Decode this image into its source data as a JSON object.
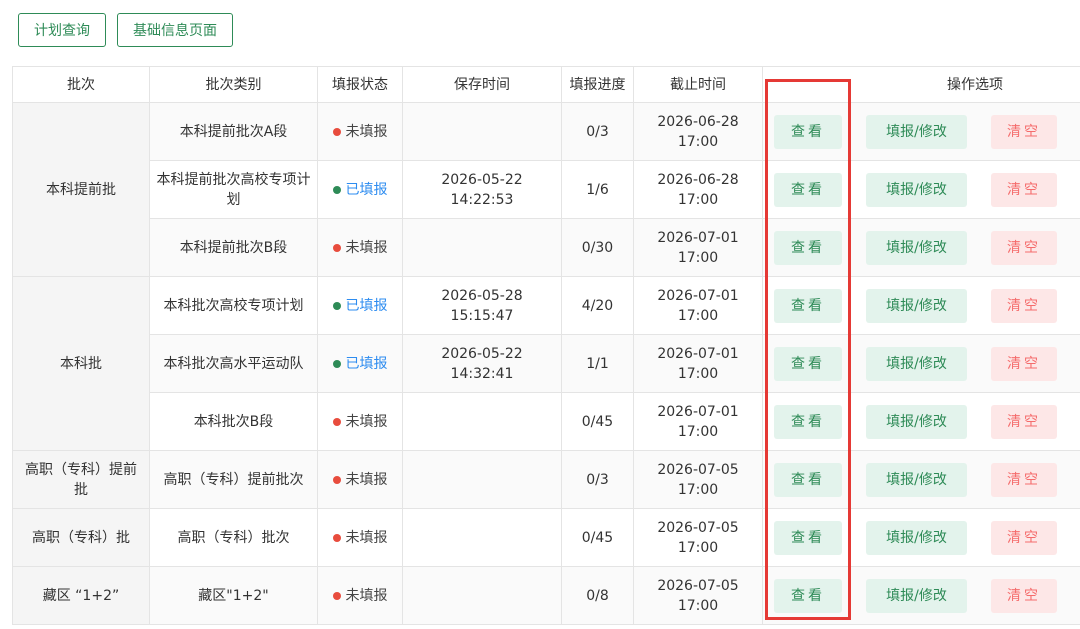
{
  "toolbar": {
    "query_label": "计划查询",
    "basic_info_label": "基础信息页面"
  },
  "table": {
    "headers": {
      "batch": "批次",
      "category": "批次类别",
      "status": "填报状态",
      "save_time": "保存时间",
      "progress": "填报进度",
      "deadline": "截止时间",
      "operations": "操作选项"
    },
    "groups": [
      {
        "name": "本科提前批",
        "rows": 3
      },
      {
        "name": "本科批",
        "rows": 3
      },
      {
        "name": "高职（专科）提前批",
        "rows": 1
      },
      {
        "name": "高职（专科）批",
        "rows": 1
      },
      {
        "name": "藏区 “1+2”",
        "rows": 1
      }
    ],
    "rows": [
      {
        "category": "本科提前批次A段",
        "status": "未填报",
        "status_type": "unfilled",
        "save_date": "",
        "save_time": "",
        "progress": "0/3",
        "deadline_date": "2026-06-28",
        "deadline_time": "17:00"
      },
      {
        "category": "本科提前批次高校专项计划",
        "status": "已填报",
        "status_type": "filled",
        "save_date": "2026-05-22",
        "save_time": "14:22:53",
        "progress": "1/6",
        "deadline_date": "2026-06-28",
        "deadline_time": "17:00"
      },
      {
        "category": "本科提前批次B段",
        "status": "未填报",
        "status_type": "unfilled",
        "save_date": "",
        "save_time": "",
        "progress": "0/30",
        "deadline_date": "2026-07-01",
        "deadline_time": "17:00"
      },
      {
        "category": "本科批次高校专项计划",
        "status": "已填报",
        "status_type": "filled",
        "save_date": "2026-05-28",
        "save_time": "15:15:47",
        "progress": "4/20",
        "deadline_date": "2026-07-01",
        "deadline_time": "17:00"
      },
      {
        "category": "本科批次高水平运动队",
        "status": "已填报",
        "status_type": "filled",
        "save_date": "2026-05-22",
        "save_time": "14:32:41",
        "progress": "1/1",
        "deadline_date": "2026-07-01",
        "deadline_time": "17:00"
      },
      {
        "category": "本科批次B段",
        "status": "未填报",
        "status_type": "unfilled",
        "save_date": "",
        "save_time": "",
        "progress": "0/45",
        "deadline_date": "2026-07-01",
        "deadline_time": "17:00"
      },
      {
        "category": "高职（专科）提前批次",
        "status": "未填报",
        "status_type": "unfilled",
        "save_date": "",
        "save_time": "",
        "progress": "0/3",
        "deadline_date": "2026-07-05",
        "deadline_time": "17:00"
      },
      {
        "category": "高职（专科）批次",
        "status": "未填报",
        "status_type": "unfilled",
        "save_date": "",
        "save_time": "",
        "progress": "0/45",
        "deadline_date": "2026-07-05",
        "deadline_time": "17:00"
      },
      {
        "category": "藏区\"1+2\"",
        "status": "未填报",
        "status_type": "unfilled",
        "save_date": "",
        "save_time": "",
        "progress": "0/8",
        "deadline_date": "2026-07-05",
        "deadline_time": "17:00"
      }
    ],
    "actions": {
      "view": "查看",
      "edit": "填报/修改",
      "clear": "清空"
    }
  },
  "colors": {
    "accent": "#2e8b57",
    "filled_text": "#2d8cf0",
    "unfilled_dot": "#e84c3d",
    "clear_text": "#f56c6c",
    "highlight_box": "#e53935"
  }
}
